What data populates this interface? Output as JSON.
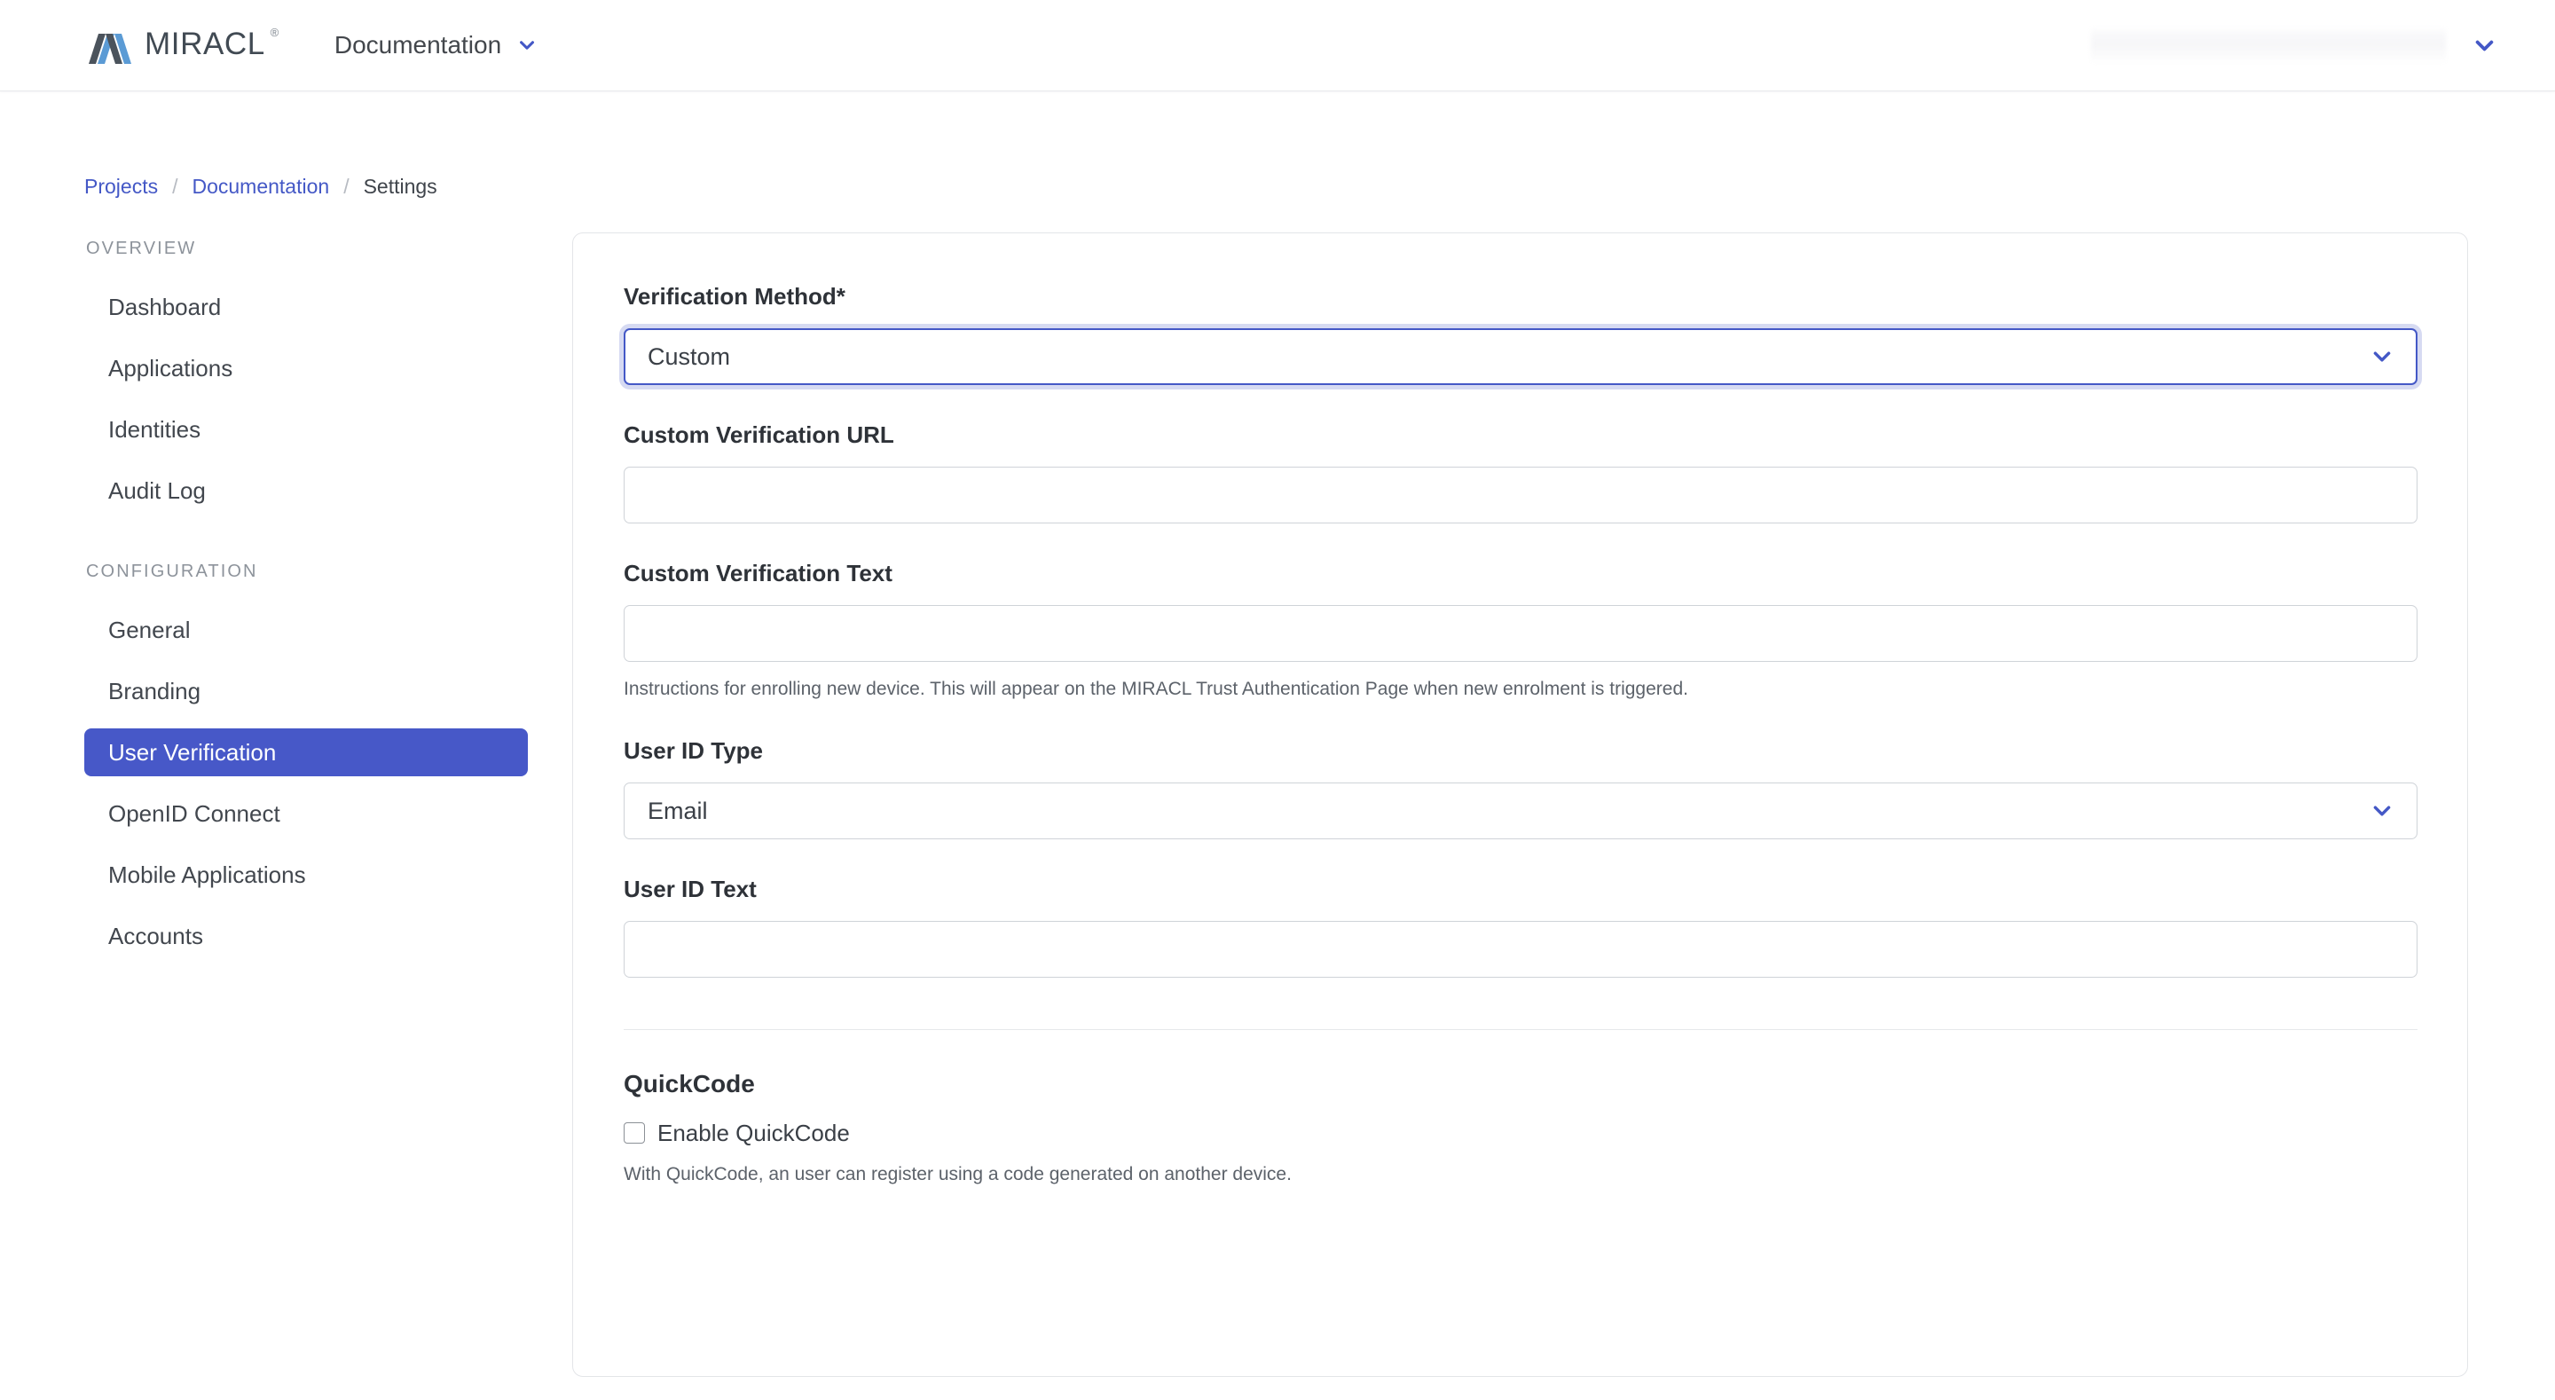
{
  "header": {
    "logo_word": "MIRACL",
    "logo_registered": "®",
    "logo_icon": "miracl-m-logo",
    "project_selector_label": "Documentation",
    "project_selector_icon": "chevron-down-icon",
    "account_menu_value": "",
    "account_menu_icon": "chevron-down-icon"
  },
  "breadcrumb": {
    "items": [
      {
        "label": "Projects",
        "type": "link"
      },
      {
        "label": "Documentation",
        "type": "link"
      },
      {
        "label": "Settings",
        "type": "current"
      }
    ],
    "separator": "/"
  },
  "sidebar": {
    "groups": [
      {
        "title": "OVERVIEW",
        "items": [
          {
            "label": "Dashboard",
            "active": false
          },
          {
            "label": "Applications",
            "active": false
          },
          {
            "label": "Identities",
            "active": false
          },
          {
            "label": "Audit Log",
            "active": false
          }
        ]
      },
      {
        "title": "CONFIGURATION",
        "items": [
          {
            "label": "General",
            "active": false
          },
          {
            "label": "Branding",
            "active": false
          },
          {
            "label": "User Verification",
            "active": true
          },
          {
            "label": "OpenID Connect",
            "active": false
          },
          {
            "label": "Mobile Applications",
            "active": false
          },
          {
            "label": "Accounts",
            "active": false
          }
        ]
      }
    ]
  },
  "form": {
    "verification_method": {
      "label": "Verification Method*",
      "value": "Custom",
      "icon": "chevron-down-icon",
      "focused": true
    },
    "custom_verification_url": {
      "label": "Custom Verification URL",
      "value": "",
      "placeholder": ""
    },
    "custom_verification_text": {
      "label": "Custom Verification Text",
      "value": "",
      "placeholder": "",
      "help": "Instructions for enrolling new device. This will appear on the MIRACL Trust Authentication Page when new enrolment is triggered."
    },
    "user_id_type": {
      "label": "User ID Type",
      "value": "Email",
      "icon": "chevron-down-icon"
    },
    "user_id_text": {
      "label": "User ID Text",
      "value": "",
      "placeholder": ""
    },
    "quickcode": {
      "section_title": "QuickCode",
      "checkbox_label": "Enable QuickCode",
      "checked": false,
      "help": "With QuickCode, an user can register using a code generated on another device."
    }
  },
  "colors": {
    "accent": "#4458c6",
    "active_nav_bg": "#4758c8",
    "logo_dark": "#4b535c",
    "logo_blue": "#5b9bd5",
    "border": "#cfd3d8",
    "card_border": "#e3e5e8"
  }
}
